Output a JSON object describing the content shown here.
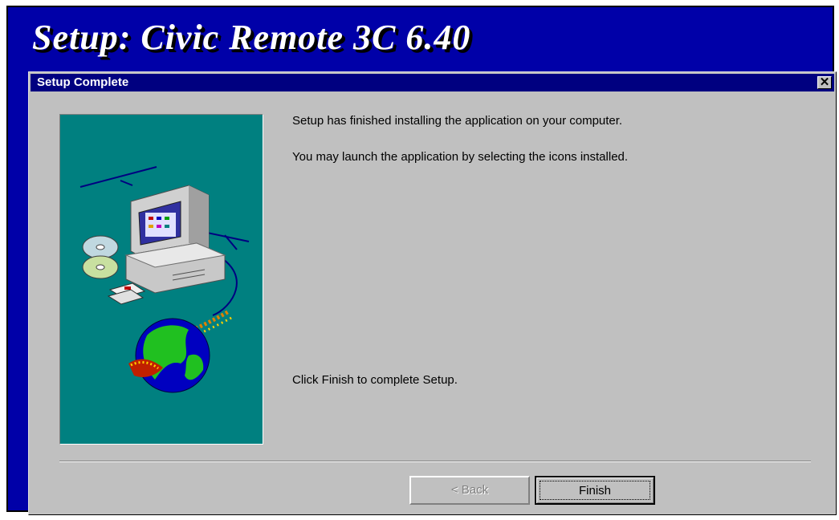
{
  "banner": {
    "title": "Setup: Civic Remote 3C 6.40"
  },
  "dialog": {
    "title": "Setup Complete",
    "close_symbol": "✕",
    "message_line1": "Setup has finished installing the application on your computer.",
    "message_line2": " You may launch the application by selecting the icons installed.",
    "message_finish": "Click Finish to complete Setup.",
    "illustration": "computer-globe-illustration"
  },
  "buttons": {
    "back_label": "< Back",
    "back_enabled": false,
    "finish_label": "Finish"
  },
  "colors": {
    "backdrop": "#0000a8",
    "titlebar": "#000080",
    "dialog_face": "#c0c0c0",
    "illustration_bg": "#008080"
  }
}
